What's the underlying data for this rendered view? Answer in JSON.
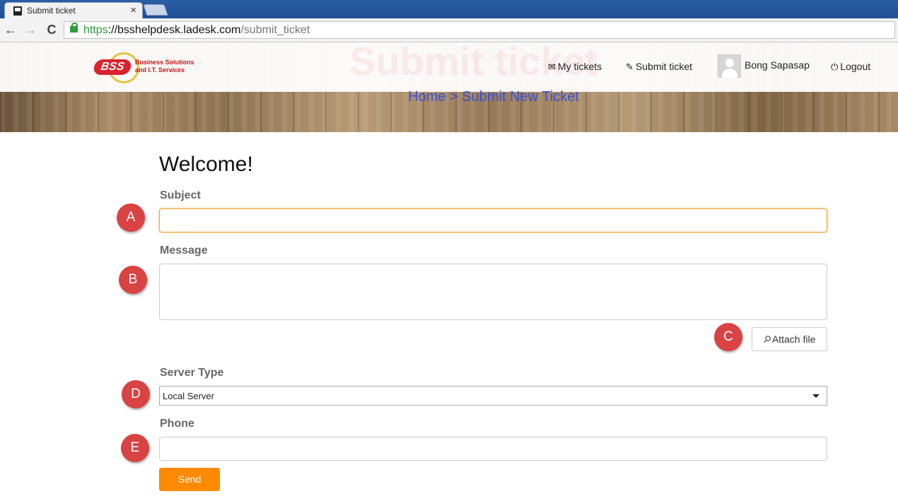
{
  "browser": {
    "tab_title": "Submit ticket",
    "tab_close": "×",
    "url_scheme": "https",
    "url_sep": "://",
    "url_host": "bsshelpdesk.ladesk.com",
    "url_path": "/submit_ticket",
    "icons": {
      "back": "←",
      "forward": "→",
      "reload": "C"
    }
  },
  "header": {
    "logo_mark": "BSS",
    "logo_line1": "Business Solutions",
    "logo_line2": "and I.T. Services",
    "ghost_title": "Submit ticket",
    "menu": {
      "my_tickets": "My tickets",
      "submit_ticket": "Submit ticket",
      "user_name": "Bong Sapasap",
      "logout": "Logout"
    },
    "breadcrumb": "Home > Submit New Ticket"
  },
  "form": {
    "welcome": "Welcome!",
    "subject_label": "Subject",
    "subject_value": "",
    "message_label": "Message",
    "message_value": "",
    "attach_label": "Attach file",
    "server_type_label": "Server Type",
    "server_type_selected": "Local Server",
    "phone_label": "Phone",
    "phone_value": "",
    "send_label": "Send"
  },
  "annotations": {
    "a": "A",
    "b": "B",
    "c": "C",
    "d": "D",
    "e": "E",
    "color": "#d94343"
  },
  "colors": {
    "accent_orange": "#ff8a00",
    "breadcrumb": "#3c4fd8",
    "url_secure": "#2e9c3a"
  }
}
